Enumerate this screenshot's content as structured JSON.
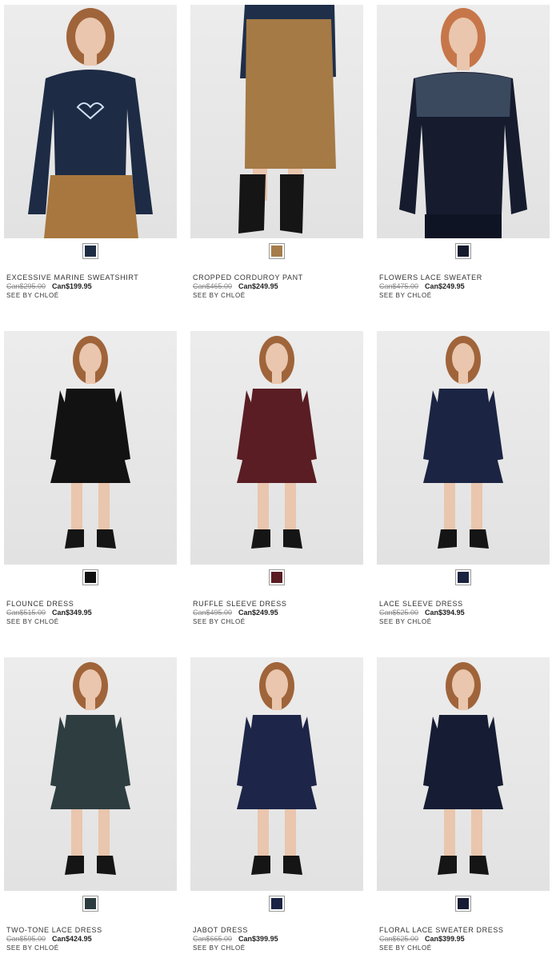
{
  "products": [
    {
      "name": "EXCESSIVE MARINE SWEATSHIRT",
      "old_price": "Can$295.00",
      "new_price": "Can$199.95",
      "brand": "SEE BY CHLOÉ",
      "swatch_color": "#1f2d44",
      "garment": "sweatshirt",
      "top_color": "#1d2b45",
      "bottom_color": "#a8773f"
    },
    {
      "name": "CROPPED CORDUROY PANT",
      "old_price": "Can$465.00",
      "new_price": "Can$249.95",
      "brand": "SEE BY CHLOÉ",
      "swatch_color": "#a57c4a",
      "garment": "pant",
      "top_color": "#1f2f4a",
      "bottom_color": "#a57a45"
    },
    {
      "name": "FLOWERS LACE SWEATER",
      "old_price": "Can$475.00",
      "new_price": "Can$249.95",
      "brand": "SEE BY CHLOÉ",
      "swatch_color": "#141a2c",
      "garment": "sweater",
      "top_color": "#161c2e",
      "bottom_color": "#161c2e"
    },
    {
      "name": "FLOUNCE DRESS",
      "old_price": "Can$515.00",
      "new_price": "Can$349.95",
      "brand": "SEE BY CHLOÉ",
      "swatch_color": "#111111",
      "garment": "dress",
      "top_color": "#121212",
      "bottom_color": "#121212"
    },
    {
      "name": "RUFFLE SLEEVE DRESS",
      "old_price": "Can$495.00",
      "new_price": "Can$249.95",
      "brand": "SEE BY CHLOÉ",
      "swatch_color": "#5a1c22",
      "garment": "dress",
      "top_color": "#5a1d24",
      "bottom_color": "#5a1d24"
    },
    {
      "name": "LACE SLEEVE DRESS",
      "old_price": "Can$525.00",
      "new_price": "Can$394.95",
      "brand": "SEE BY CHLOÉ",
      "swatch_color": "#1a2340",
      "garment": "dress",
      "top_color": "#1b2442",
      "bottom_color": "#1b2442"
    },
    {
      "name": "TWO-TONE LACE DRESS",
      "old_price": "Can$595.00",
      "new_price": "Can$424.95",
      "brand": "SEE BY CHLOÉ",
      "swatch_color": "#2c3c3e",
      "garment": "dress",
      "top_color": "#2d3d40",
      "bottom_color": "#2d3d40"
    },
    {
      "name": "JABOT DRESS",
      "old_price": "Can$665.00",
      "new_price": "Can$399.95",
      "brand": "SEE BY CHLOÉ",
      "swatch_color": "#1c2446",
      "garment": "dress",
      "top_color": "#1d2548",
      "bottom_color": "#1d2548"
    },
    {
      "name": "FLORAL LACE SWEATER DRESS",
      "old_price": "Can$625.00",
      "new_price": "Can$399.95",
      "brand": "SEE BY CHLOÉ",
      "swatch_color": "#151b33",
      "garment": "dress",
      "top_color": "#151c34",
      "bottom_color": "#151c34"
    }
  ]
}
